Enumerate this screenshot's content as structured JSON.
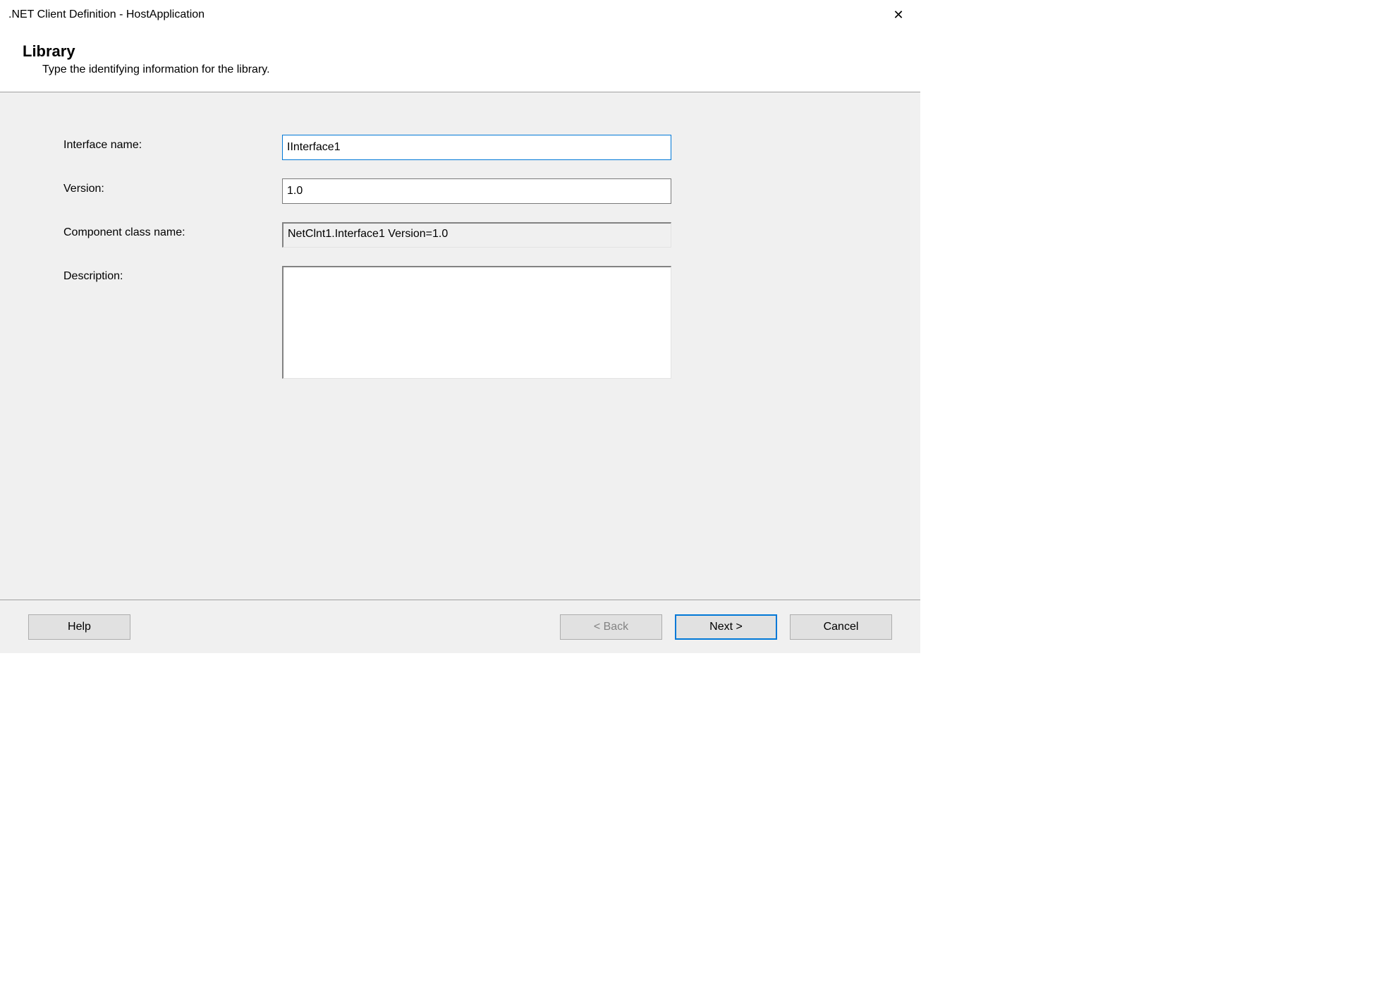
{
  "window": {
    "title": ".NET Client Definition - HostApplication"
  },
  "header": {
    "title": "Library",
    "subtitle": "Type the identifying information for the library."
  },
  "form": {
    "interface_name_label": "Interface name:",
    "interface_name_value": "IInterface1",
    "version_label": "Version:",
    "version_value": "1.0",
    "component_class_label": "Component class name:",
    "component_class_value": "NetClnt1.Interface1 Version=1.0",
    "description_label": "Description:",
    "description_value": ""
  },
  "buttons": {
    "help": "Help",
    "back": "< Back",
    "next": "Next >",
    "cancel": "Cancel"
  }
}
